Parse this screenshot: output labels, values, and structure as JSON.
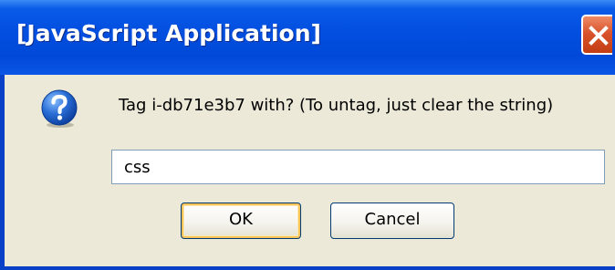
{
  "window": {
    "title": "[JavaScript Application]"
  },
  "icons": {
    "dialog_icon": "question-mark-icon",
    "close_icon": "close-icon"
  },
  "prompt": {
    "message": "Tag i-db71e3b7 with? (To untag, just clear the string)",
    "input_value": "css"
  },
  "buttons": {
    "ok_label": "OK",
    "cancel_label": "Cancel"
  },
  "colors": {
    "titlebar": "#0350e0",
    "close_button": "#d9542c",
    "dialog_background": "#ece9d8",
    "icon_blue": "#2a6fd6"
  }
}
